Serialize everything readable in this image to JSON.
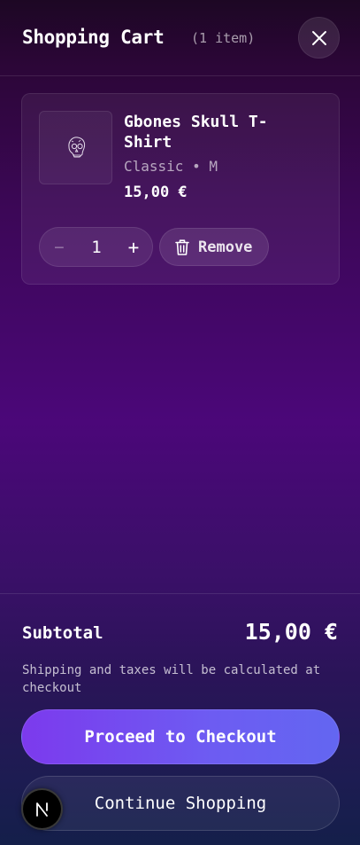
{
  "header": {
    "title": "Shopping Cart",
    "item_count": "(1 item)",
    "close_icon": "close-icon"
  },
  "cart": {
    "items": [
      {
        "name": "Gbones Skull T-Shirt",
        "variant": "Classic • M",
        "price": "15,00 €",
        "quantity": "1",
        "minus_label": "−",
        "plus_label": "+",
        "remove_label": "Remove",
        "thumbnail_icon": "skull-icon",
        "remove_icon": "trash-icon"
      }
    ]
  },
  "footer": {
    "subtotal_label": "Subtotal",
    "subtotal_value": "15,00 €",
    "shipping_note": "Shipping and taxes will be calculated at checkout",
    "checkout_label": "Proceed to Checkout",
    "continue_label": "Continue Shopping"
  },
  "badge": {
    "letter": "N",
    "icon": "nextjs-icon"
  },
  "colors": {
    "accent_start": "#7c3aed",
    "accent_end": "#6366f1",
    "background_top": "#1d0724",
    "background_mid": "#4b0779",
    "background_bottom": "#141f4a"
  }
}
